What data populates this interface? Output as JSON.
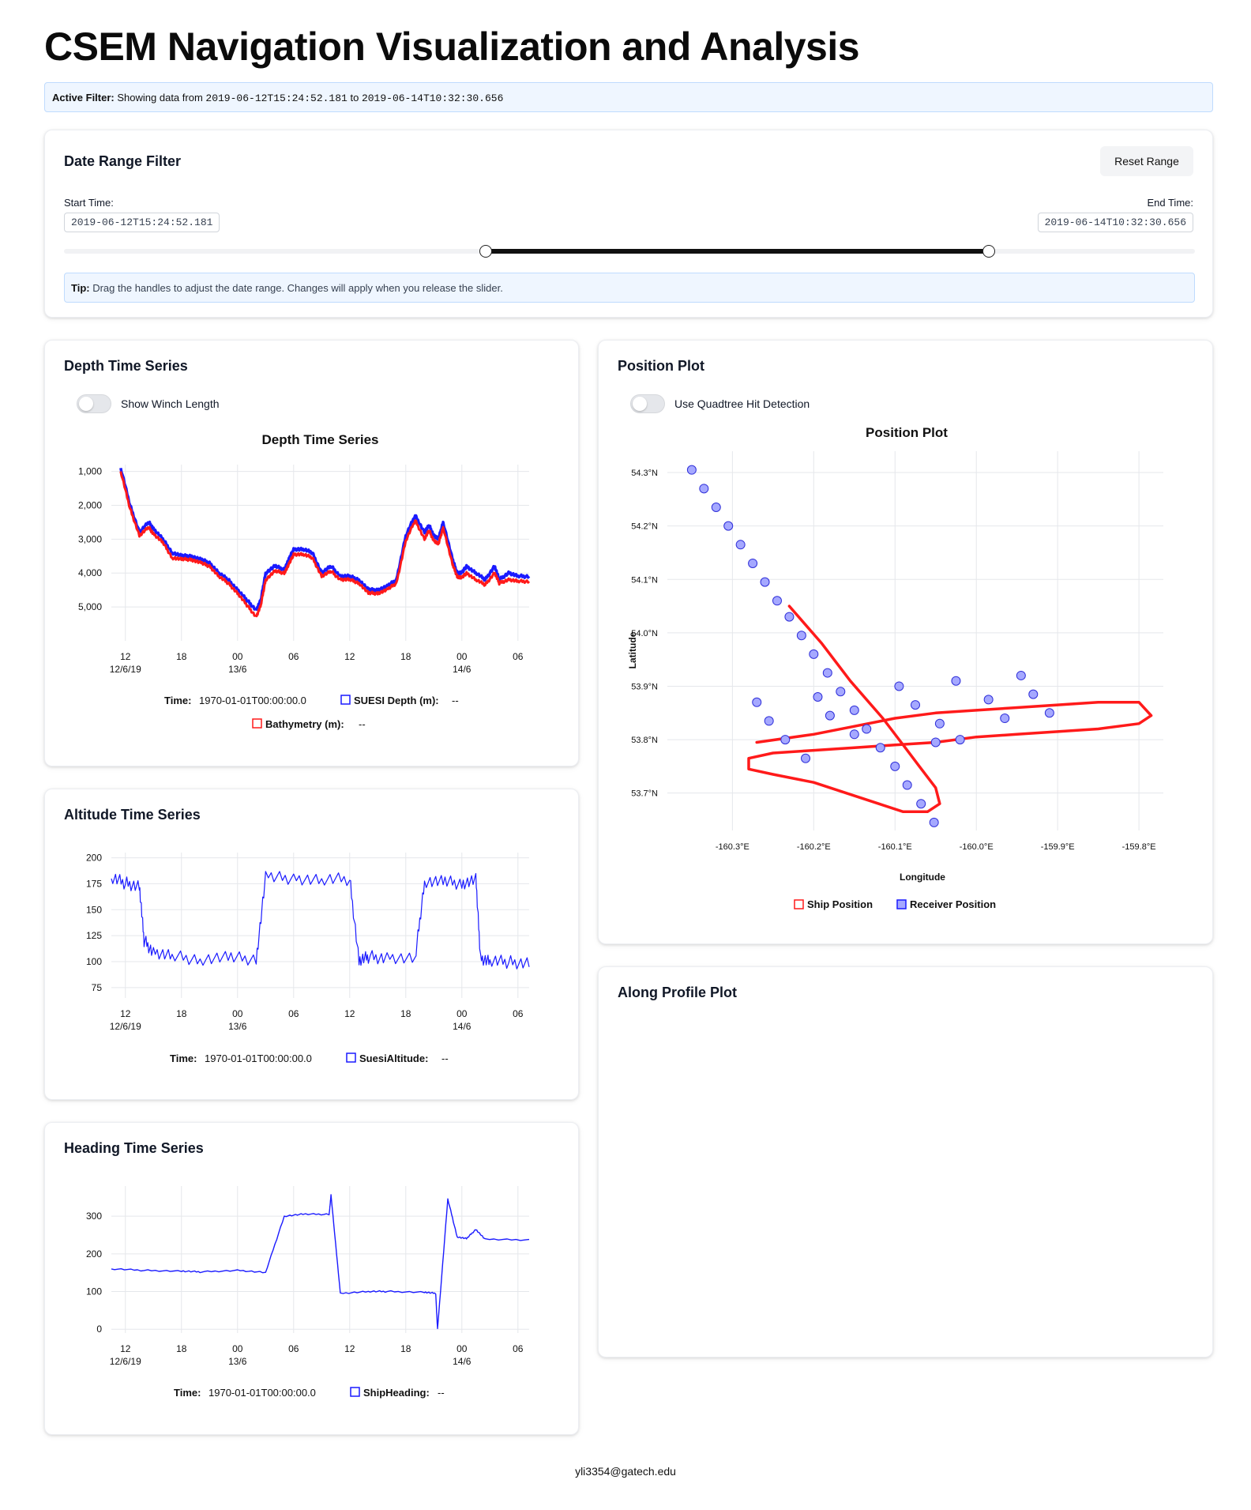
{
  "app_title": "CSEM Navigation Visualization and Analysis",
  "active_filter": {
    "label": "Active Filter:",
    "prefix": "Showing data from",
    "start": "2019-06-12T15:24:52.181",
    "joiner": "to",
    "end": "2019-06-14T10:32:30.656"
  },
  "date_range": {
    "title": "Date Range Filter",
    "reset_label": "Reset Range",
    "start_label": "Start Time:",
    "start_value": "2019-06-12T15:24:52.181",
    "end_label": "End Time:",
    "end_value": "2019-06-14T10:32:30.656",
    "slider_low_fraction": 0.373,
    "slider_high_fraction": 0.818,
    "tip_label": "Tip:",
    "tip_text": "Drag the handles to adjust the date range. Changes will apply when you release the slider."
  },
  "time_axis": {
    "ticks": [
      "12",
      "18",
      "00",
      "06",
      "12",
      "18",
      "00",
      "06"
    ],
    "subticks": [
      "12/6/19",
      "13/6",
      "14/6"
    ]
  },
  "depth": {
    "card_title": "Depth Time Series",
    "toggle_label": "Show Winch Length",
    "toggle_on": false,
    "plot_title": "Depth Time Series",
    "time_label": "Time:",
    "time_value": "1970-01-01T00:00:00.0",
    "suesi_label": "SUESI Depth (m):",
    "suesi_value": "--",
    "bathy_label": "Bathymetry (m):",
    "bathy_value": "--",
    "colors": {
      "suesi": "#1a1aff",
      "bathy": "#ff1a1a"
    }
  },
  "altitude": {
    "card_title": "Altitude Time Series",
    "time_label": "Time:",
    "time_value": "1970-01-01T00:00:00.0",
    "series_label": "SuesiAltitude:",
    "series_value": "--"
  },
  "heading": {
    "card_title": "Heading Time Series",
    "time_label": "Time:",
    "time_value": "1970-01-01T00:00:00.0",
    "series_label": "ShipHeading:",
    "series_value": "--"
  },
  "position": {
    "card_title": "Position Plot",
    "toggle_label": "Use Quadtree Hit Detection",
    "toggle_on": false,
    "plot_title": "Position Plot",
    "xlabel": "Longitude",
    "ylabel": "Latitude",
    "legend_ship": "Ship Position",
    "legend_receiver": "Receiver Position",
    "colors": {
      "ship": "#ff1a1a",
      "receiver": "#1a1aff"
    }
  },
  "along_profile": {
    "card_title": "Along Profile Plot"
  },
  "footer_email": "yli3354@gatech.edu",
  "chart_data": [
    {
      "type": "line",
      "title": "Depth Time Series",
      "x_unit": "hours since 2019-06-12 00:00",
      "xlim": [
        10.5,
        55.2
      ],
      "ylim": [
        6000,
        800
      ],
      "y_inverted": true,
      "y_ticks": [
        1000,
        2000,
        3000,
        4000,
        5000
      ],
      "y_tick_labels": [
        "1,000",
        "2,000",
        "3,000",
        "4,000",
        "5,000"
      ],
      "x_ticks": [
        12,
        18,
        24,
        30,
        36,
        42,
        48,
        54
      ],
      "series": [
        {
          "name": "SUESI Depth (m)",
          "x": [
            11.5,
            12.5,
            13.5,
            14.5,
            15.0,
            16.0,
            17.0,
            18.0,
            19.0,
            20.0,
            21.0,
            22.0,
            23.0,
            24.0,
            25.0,
            26.0,
            26.5,
            27.0,
            28.0,
            29.0,
            29.5,
            30.0,
            31.0,
            32.0,
            33.0,
            34.0,
            35.0,
            36.0,
            37.0,
            38.0,
            39.0,
            40.0,
            41.0,
            42.0,
            43.0,
            44.0,
            44.5,
            45.0,
            45.5,
            46.0,
            47.0,
            47.5,
            48.0,
            48.5,
            49.5,
            50.5,
            51.5,
            52.0,
            53.0,
            54.0,
            55.2
          ],
          "y": [
            900,
            2000,
            2800,
            2500,
            2700,
            3000,
            3400,
            3500,
            3500,
            3600,
            3700,
            4000,
            4200,
            4500,
            4800,
            5100,
            4800,
            4000,
            3800,
            3900,
            3600,
            3300,
            3300,
            3400,
            4000,
            3800,
            4100,
            4100,
            4200,
            4500,
            4500,
            4400,
            4200,
            2900,
            2300,
            2800,
            2600,
            2900,
            3000,
            2500,
            3600,
            4000,
            4000,
            3800,
            4000,
            4200,
            3800,
            4200,
            4000,
            4100,
            4100
          ]
        },
        {
          "name": "Bathymetry (m)",
          "x": [
            11.5,
            12.5,
            13.5,
            14.5,
            15.0,
            16.0,
            17.0,
            18.0,
            19.0,
            20.0,
            21.0,
            22.0,
            23.0,
            24.0,
            25.0,
            26.0,
            26.5,
            27.0,
            28.0,
            29.0,
            29.5,
            30.0,
            31.0,
            32.0,
            33.0,
            34.0,
            35.0,
            36.0,
            37.0,
            38.0,
            39.0,
            40.0,
            41.0,
            42.0,
            43.0,
            44.0,
            44.5,
            45.0,
            45.5,
            46.0,
            47.0,
            47.5,
            48.0,
            48.5,
            49.5,
            50.5,
            51.5,
            52.0,
            53.0,
            54.0,
            55.2
          ],
          "y": [
            1000,
            2100,
            2900,
            2650,
            2850,
            3100,
            3550,
            3600,
            3600,
            3700,
            3800,
            4100,
            4300,
            4600,
            4950,
            5300,
            4950,
            4200,
            3950,
            4000,
            3750,
            3450,
            3450,
            3550,
            4100,
            3950,
            4200,
            4200,
            4300,
            4600,
            4600,
            4500,
            4300,
            3050,
            2450,
            3000,
            2750,
            3050,
            3150,
            2650,
            3750,
            4100,
            4150,
            4000,
            4200,
            4350,
            4000,
            4300,
            4200,
            4250,
            4250
          ]
        }
      ]
    },
    {
      "type": "line",
      "title": "Altitude Time Series",
      "x_unit": "hours since 2019-06-12 00:00",
      "xlim": [
        10.5,
        55.2
      ],
      "ylim": [
        65,
        205
      ],
      "y_ticks": [
        75,
        100,
        125,
        150,
        175,
        200
      ],
      "x_ticks": [
        12,
        18,
        24,
        30,
        36,
        42,
        48,
        54
      ],
      "series": [
        {
          "name": "SuesiAltitude",
          "x": [
            10.5,
            12.0,
            13.5,
            14.0,
            15.0,
            17.0,
            20.0,
            23.0,
            26.0,
            27.0,
            30.0,
            33.0,
            36.0,
            37.0,
            38.0,
            40.0,
            43.0,
            44.0,
            46.0,
            48.0,
            49.5,
            50.0,
            51.0,
            53.0,
            55.2
          ],
          "y": [
            180,
            175,
            172,
            120,
            108,
            104,
            102,
            103,
            102,
            180,
            180,
            178,
            179,
            100,
            104,
            103,
            101,
            177,
            176,
            175,
            178,
            103,
            100,
            99,
            98
          ]
        }
      ]
    },
    {
      "type": "line",
      "title": "Heading Time Series",
      "x_unit": "hours since 2019-06-12 00:00",
      "xlim": [
        10.5,
        55.2
      ],
      "ylim": [
        -10,
        380
      ],
      "y_ticks": [
        0,
        100,
        200,
        300
      ],
      "x_ticks": [
        12,
        18,
        24,
        30,
        36,
        42,
        48,
        54
      ],
      "series": [
        {
          "name": "ShipHeading",
          "x": [
            10.5,
            14.0,
            18.0,
            20.0,
            24.0,
            27.0,
            29.0,
            31.0,
            33.8,
            34.0,
            35.0,
            38.0,
            40.0,
            44.0,
            45.2,
            45.4,
            46.5,
            47.5,
            48.5,
            49.5,
            50.5,
            55.2
          ],
          "y": [
            160,
            156,
            154,
            152,
            156,
            150,
            300,
            305,
            305,
            355,
            95,
            100,
            100,
            98,
            95,
            0,
            345,
            245,
            240,
            265,
            238,
            237
          ]
        }
      ]
    },
    {
      "type": "scatter",
      "title": "Position Plot",
      "xlabel": "Longitude",
      "ylabel": "Latitude",
      "xlim": [
        -160.38,
        -159.77
      ],
      "ylim": [
        53.63,
        54.34
      ],
      "x_ticks": [
        -160.3,
        -160.2,
        -160.1,
        -160.0,
        -159.9,
        -159.8
      ],
      "x_tick_labels": [
        "-160.3°E",
        "-160.2°E",
        "-160.1°E",
        "-160.0°E",
        "-159.9°E",
        "-159.8°E"
      ],
      "y_ticks": [
        53.7,
        53.8,
        53.9,
        54.0,
        54.1,
        54.2,
        54.3
      ],
      "y_tick_labels": [
        "53.7°N",
        "53.8°N",
        "53.9°N",
        "54.0°N",
        "54.1°N",
        "54.2°N",
        "54.3°N"
      ],
      "series": [
        {
          "name": "Ship Position",
          "kind": "line",
          "x": [
            -160.23,
            -160.19,
            -160.155,
            -160.115,
            -160.09,
            -160.07,
            -160.05,
            -160.045,
            -160.06,
            -160.09,
            -160.12,
            -160.16,
            -160.2,
            -160.25,
            -160.28,
            -160.28,
            -160.25,
            -160.2,
            -160.15,
            -160.1,
            -160.05,
            -160.0,
            -159.95,
            -159.9,
            -159.85,
            -159.8,
            -159.785,
            -159.8,
            -159.85,
            -159.9,
            -159.95,
            -160.0,
            -160.05,
            -160.1,
            -160.15,
            -160.2,
            -160.27
          ],
          "x_": [],
          "y": [
            54.05,
            53.98,
            53.91,
            53.84,
            53.79,
            53.75,
            53.71,
            53.68,
            53.665,
            53.665,
            53.68,
            53.7,
            53.72,
            53.735,
            53.745,
            53.765,
            53.775,
            53.78,
            53.785,
            53.79,
            53.795,
            53.805,
            53.81,
            53.815,
            53.82,
            53.83,
            53.845,
            53.87,
            53.87,
            53.865,
            53.86,
            53.855,
            53.85,
            53.84,
            53.825,
            53.81,
            53.795
          ]
        },
        {
          "name": "Receiver Position",
          "kind": "points",
          "x": [
            -160.35,
            -160.335,
            -160.32,
            -160.305,
            -160.29,
            -160.275,
            -160.26,
            -160.245,
            -160.23,
            -160.215,
            -160.2,
            -160.183,
            -160.167,
            -160.15,
            -160.135,
            -160.118,
            -160.1,
            -160.085,
            -160.068,
            -160.052,
            -160.27,
            -160.255,
            -160.235,
            -160.21,
            -160.195,
            -160.18,
            -160.15,
            -160.095,
            -160.075,
            -160.045,
            -160.025,
            -159.985,
            -159.965,
            -159.945,
            -159.93,
            -159.91,
            -160.02,
            -160.05
          ],
          "y": [
            54.305,
            54.27,
            54.235,
            54.2,
            54.165,
            54.13,
            54.095,
            54.06,
            54.03,
            53.995,
            53.96,
            53.925,
            53.89,
            53.855,
            53.82,
            53.785,
            53.75,
            53.715,
            53.68,
            53.645,
            53.87,
            53.835,
            53.8,
            53.765,
            53.88,
            53.845,
            53.81,
            53.9,
            53.865,
            53.83,
            53.91,
            53.875,
            53.84,
            53.92,
            53.885,
            53.85,
            53.8,
            53.795
          ]
        }
      ]
    }
  ]
}
